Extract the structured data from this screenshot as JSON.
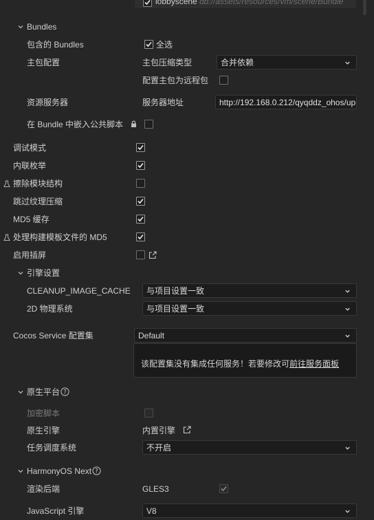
{
  "top_row": {
    "scene_name": "lobbyscene",
    "scene_path": "db://assets/resources/vm/scene/Bundle",
    "checked": true
  },
  "bundles": {
    "section_label": "Bundles",
    "include_label": "包含的 Bundles",
    "select_all_label": "全选",
    "select_all_checked": true,
    "main_config_label": "主包配置",
    "compress_type_label": "主包压缩类型",
    "compress_type_value": "合并依赖",
    "remote_label": "配置主包为远程包",
    "remote_checked": false,
    "server_label": "资源服务器",
    "server_addr_label": "服务器地址",
    "server_addr_value": "http://192.168.0.212/qyqddz_ohos/up",
    "embed_label": "在 Bundle 中嵌入公共脚本",
    "embed_checked": false
  },
  "options": [
    {
      "label": "调试模式",
      "checked": true,
      "flask": false
    },
    {
      "label": "内联枚举",
      "checked": true,
      "flask": false
    },
    {
      "label": "擦除模块结构",
      "checked": false,
      "flask": true
    },
    {
      "label": "跳过纹理压缩",
      "checked": true,
      "flask": false
    },
    {
      "label": "MD5 缓存",
      "checked": true,
      "flask": false
    },
    {
      "label": "处理构建模板文件的 MD5",
      "checked": true,
      "flask": true
    },
    {
      "label": "启用插屏",
      "checked": false,
      "flask": false
    }
  ],
  "engine": {
    "section_label": "引擎设置",
    "cleanup_label": "CLEANUP_IMAGE_CACHE",
    "cleanup_value": "与项目设置一致",
    "physics_label": "2D 物理系统",
    "physics_value": "与项目设置一致"
  },
  "cocos_service": {
    "label": "Cocos Service 配置集",
    "value": "Default",
    "notice": "该配置集没有集成任何服务！若要修改可",
    "link": "前往服务面板"
  },
  "native": {
    "section_label": "原生平台",
    "encrypt_label": "加密脚本",
    "encrypt_checked": false,
    "engine_label": "原生引擎",
    "engine_value": "内置引擎",
    "scheduler_label": "任务调度系统",
    "scheduler_value": "不开启"
  },
  "harmony": {
    "section_label": "HarmonyOS Next",
    "render_label": "渲染后端",
    "render_value": "GLES3",
    "render_checked": true,
    "js_engine_label": "JavaScript 引擎",
    "js_engine_value": "V8"
  },
  "colors": {
    "background": "#262626",
    "field": "#1c1c1c",
    "text": "#cfcfcf",
    "muted": "#8a8a8a"
  }
}
